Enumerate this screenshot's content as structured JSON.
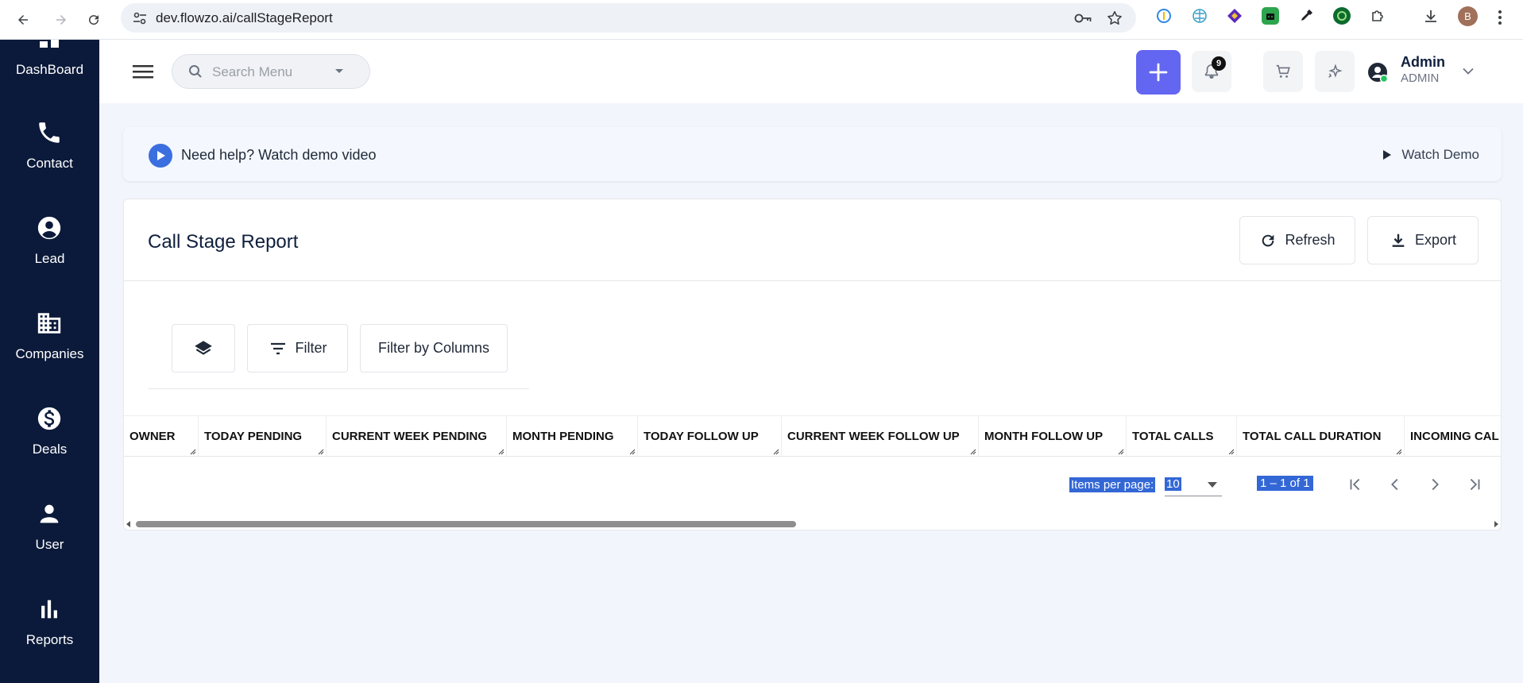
{
  "browser": {
    "url": "dev.flowzo.ai/callStageReport",
    "profile_initial": "B"
  },
  "sidebar": {
    "items": [
      {
        "label": "DashBoard",
        "icon": "dashboard-icon"
      },
      {
        "label": "Contact",
        "icon": "phone-icon"
      },
      {
        "label": "Lead",
        "icon": "account-circle-icon"
      },
      {
        "label": "Companies",
        "icon": "building-icon"
      },
      {
        "label": "Deals",
        "icon": "dollar-icon"
      },
      {
        "label": "User",
        "icon": "person-icon"
      },
      {
        "label": "Reports",
        "icon": "bar-chart-icon"
      }
    ]
  },
  "header": {
    "search_placeholder": "Search Menu",
    "notification_count": "9",
    "user_name": "Admin",
    "user_role": "ADMIN"
  },
  "banner": {
    "help_text": "Need help? Watch demo video",
    "watch_demo_label": "Watch Demo"
  },
  "report": {
    "title": "Call Stage Report",
    "refresh_label": "Refresh",
    "export_label": "Export",
    "filter_label": "Filter",
    "filter_columns_label": "Filter by Columns",
    "columns": [
      "OWNER",
      "TODAY PENDING",
      "CURRENT WEEK PENDING",
      "MONTH PENDING",
      "TODAY FOLLOW UP",
      "CURRENT WEEK FOLLOW UP",
      "MONTH FOLLOW UP",
      "TOTAL CALLS",
      "TOTAL CALL DURATION",
      "INCOMING CAL"
    ]
  },
  "paginator": {
    "items_per_page_label": "Items per page:",
    "page_size": "10",
    "range_label": "1 – 1 of 1"
  },
  "colors": {
    "sidebar_bg": "#0b1a3a",
    "accent": "#6366f1",
    "selection": "#3367d6"
  }
}
